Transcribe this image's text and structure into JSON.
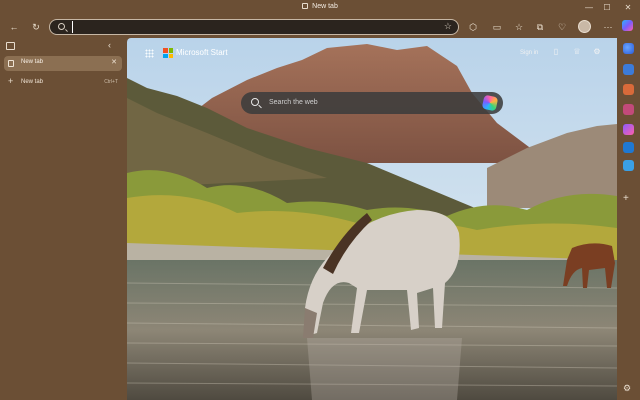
{
  "window": {
    "title": "New tab",
    "minimize_glyph": "—",
    "maximize_glyph": "☐",
    "close_glyph": "✕"
  },
  "toolbar": {
    "back_glyph": "←",
    "refresh_glyph": "↻",
    "address_value": "",
    "favorite_glyph": "☆",
    "icons": [
      "extensions-icon",
      "split-screen-icon",
      "favorites-icon",
      "collections-icon",
      "browser-essentials-icon",
      "profile-avatar",
      "more-icon",
      "copilot-icon"
    ],
    "more_glyph": "⋯"
  },
  "sidebar": {
    "collapse_glyph": "‹",
    "tabs": [
      {
        "label": "New tab",
        "active": true,
        "close_glyph": "✕"
      }
    ],
    "new_tab": {
      "label": "New tab",
      "shortcut": "Ctrl+T",
      "glyph": "+"
    }
  },
  "newtab_page": {
    "brand": "Microsoft Start",
    "signin": "Sign in",
    "search_placeholder": "Search the web",
    "header_icons": [
      "phone-icon",
      "rewards-icon",
      "settings-icon"
    ],
    "background": "Desert river with wild horses drinking"
  },
  "rail": {
    "icons": [
      "search-rail-icon",
      "shopping-rail-icon",
      "tools-rail-icon",
      "games-rail-icon",
      "copilot-rail-icon",
      "outlook-rail-icon",
      "send-rail-icon"
    ],
    "add_glyph": "+",
    "settings_glyph": "⚙"
  },
  "colors": {
    "chrome": "#6b4f35",
    "active_tab": "#8b6f52",
    "address_bg": "#2b241e"
  }
}
